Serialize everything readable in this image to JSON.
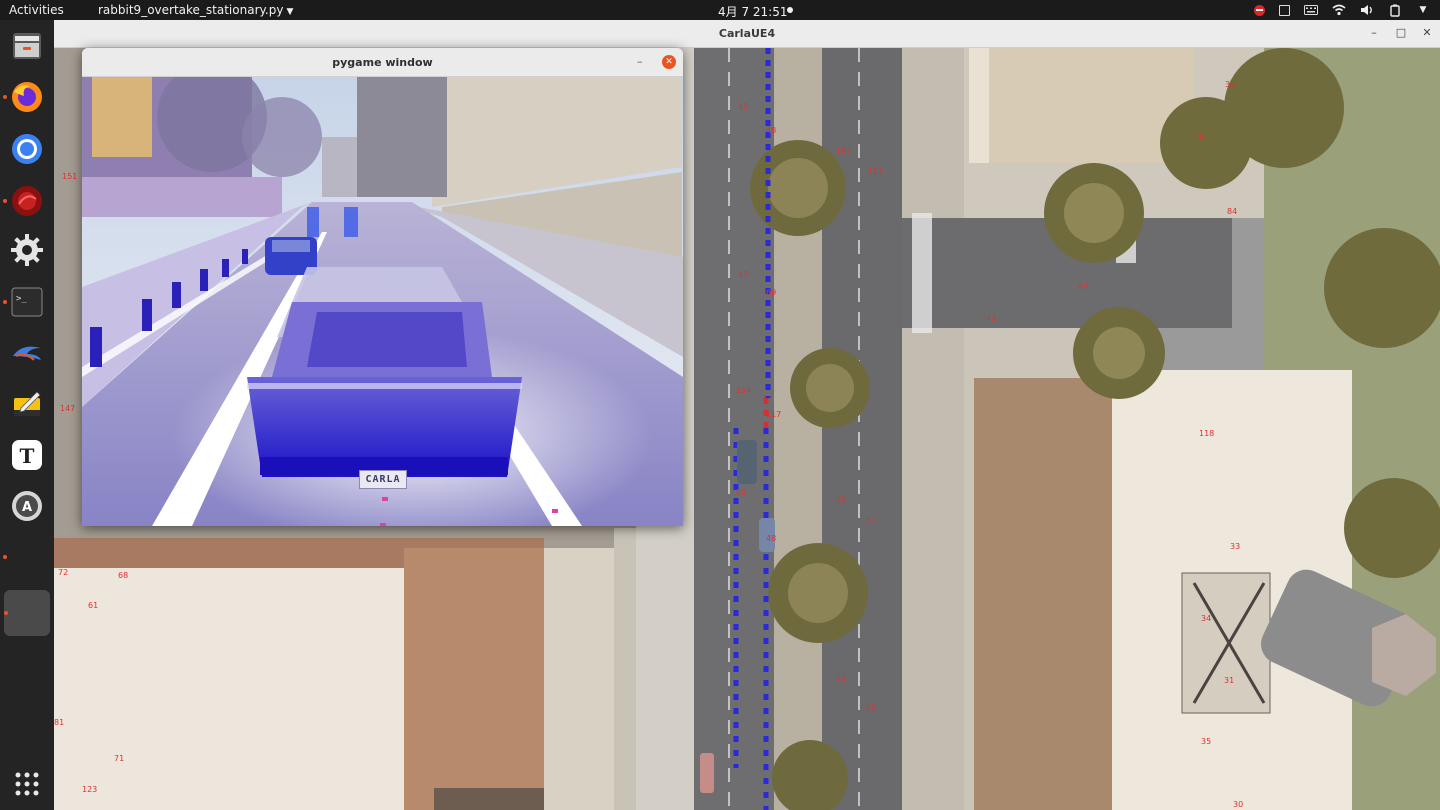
{
  "topbar": {
    "activities": "Activities",
    "app_name": "rabbit9_overtake_stationary.py",
    "clock": "4月 7  21:51"
  },
  "dock": {
    "items": [
      {
        "name": "files",
        "icon": "file-cabinet-icon"
      },
      {
        "name": "firefox",
        "icon": "firefox-icon"
      },
      {
        "name": "chromium",
        "icon": "chromium-icon"
      },
      {
        "name": "remmina",
        "icon": "remote-desktop-icon"
      },
      {
        "name": "settings",
        "icon": "gear-icon"
      },
      {
        "name": "terminal",
        "icon": "terminal-icon"
      },
      {
        "name": "kdenlive",
        "icon": "bird-icon"
      },
      {
        "name": "text-editor",
        "icon": "notepad-icon"
      },
      {
        "name": "typora",
        "icon": "typography-icon"
      },
      {
        "name": "software-updater",
        "icon": "updater-icon"
      },
      {
        "name": "active-app",
        "icon": "blank-app-icon"
      },
      {
        "name": "show-apps",
        "icon": "grid-icon"
      }
    ]
  },
  "carla_window": {
    "title": "CarlaUE4",
    "markers": [
      "45",
      "48",
      "107",
      "115",
      "36",
      "49",
      "84",
      "47",
      "69",
      "97",
      "43",
      "134",
      "117",
      "118",
      "55",
      "57",
      "56",
      "50",
      "48",
      "33",
      "34",
      "53",
      "55",
      "31",
      "35",
      "30",
      "52",
      "151",
      "147",
      "72",
      "68",
      "61",
      "81",
      "71",
      "123"
    ]
  },
  "pygame_window": {
    "title": "pygame window",
    "plate": "CARLA"
  },
  "colors": {
    "topbar": "#1b1b1b",
    "dock": "#242424",
    "accent": "#e95420",
    "marker": "#e23030",
    "lane_blue": "#2a2ad8"
  }
}
